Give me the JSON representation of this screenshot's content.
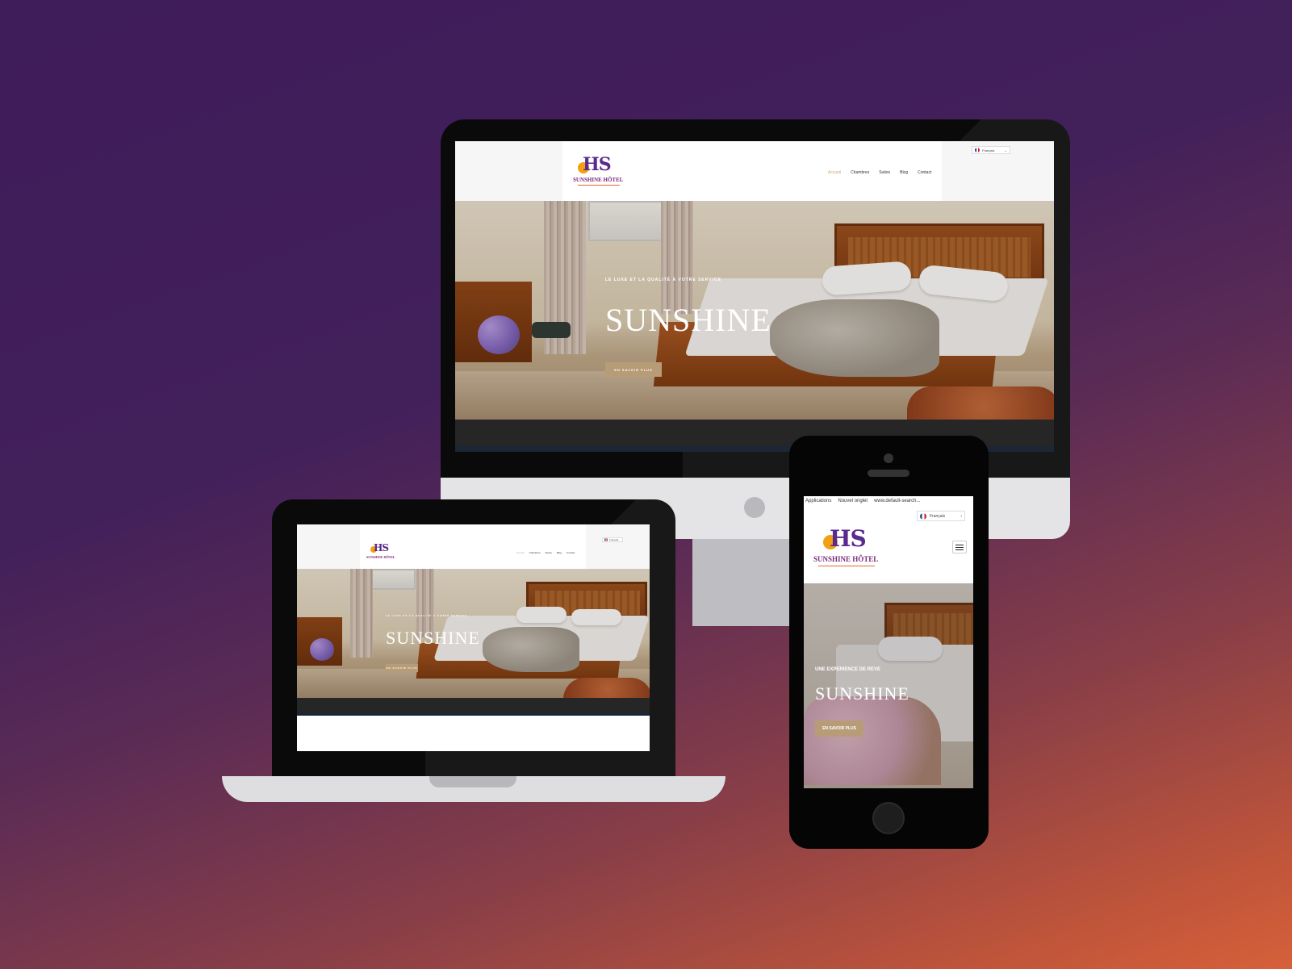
{
  "colors": {
    "background_top": "#3f1c5a",
    "background_bottom": "#d6603a",
    "accent_gold": "#b89c78",
    "nav_active": "#c9a77a",
    "brand_purple": "#5a2a8c",
    "brand_orange": "#f2a014"
  },
  "desktop": {
    "logo": {
      "mark": "HS",
      "brand": "SUNSHINE HÔTEL"
    },
    "nav": [
      "Accueil",
      "Chambres",
      "Suites",
      "Blog",
      "Contact"
    ],
    "lang": {
      "label": "Français",
      "icon": "chevron-down-icon"
    },
    "hero": {
      "kicker": "LE LUXE ET LA QUALITÉ À VOTRE SERVICE",
      "title": "SUNSHINE",
      "button": "EN SAVOIR PLUS"
    }
  },
  "laptop": {
    "logo": {
      "mark": "HS",
      "brand": "SUNSHINE HÔTEL"
    },
    "nav": [
      "Accueil",
      "Chambres",
      "Suites",
      "Blog",
      "Contact"
    ],
    "lang": {
      "label": "Français"
    },
    "hero": {
      "kicker": "LE LUXE ET LA QUALITÉ À VOTRE SERVICE",
      "title": "SUNSHINE",
      "button": "EN SAVOIR PLUS"
    }
  },
  "phone": {
    "bookmarks": [
      "Applications",
      "Nouvel onglet",
      "www.default-search..."
    ],
    "logo": {
      "mark": "HS",
      "brand": "SUNSHINE HÔTEL"
    },
    "lang": {
      "label": "Français",
      "icon": "chevron-down-icon"
    },
    "menu_icon": "hamburger-icon",
    "hero": {
      "kicker": "UNE EXPERIENCE DE REVE",
      "title": "SUNSHINE",
      "button": "EN SAVOIR PLUS"
    }
  }
}
